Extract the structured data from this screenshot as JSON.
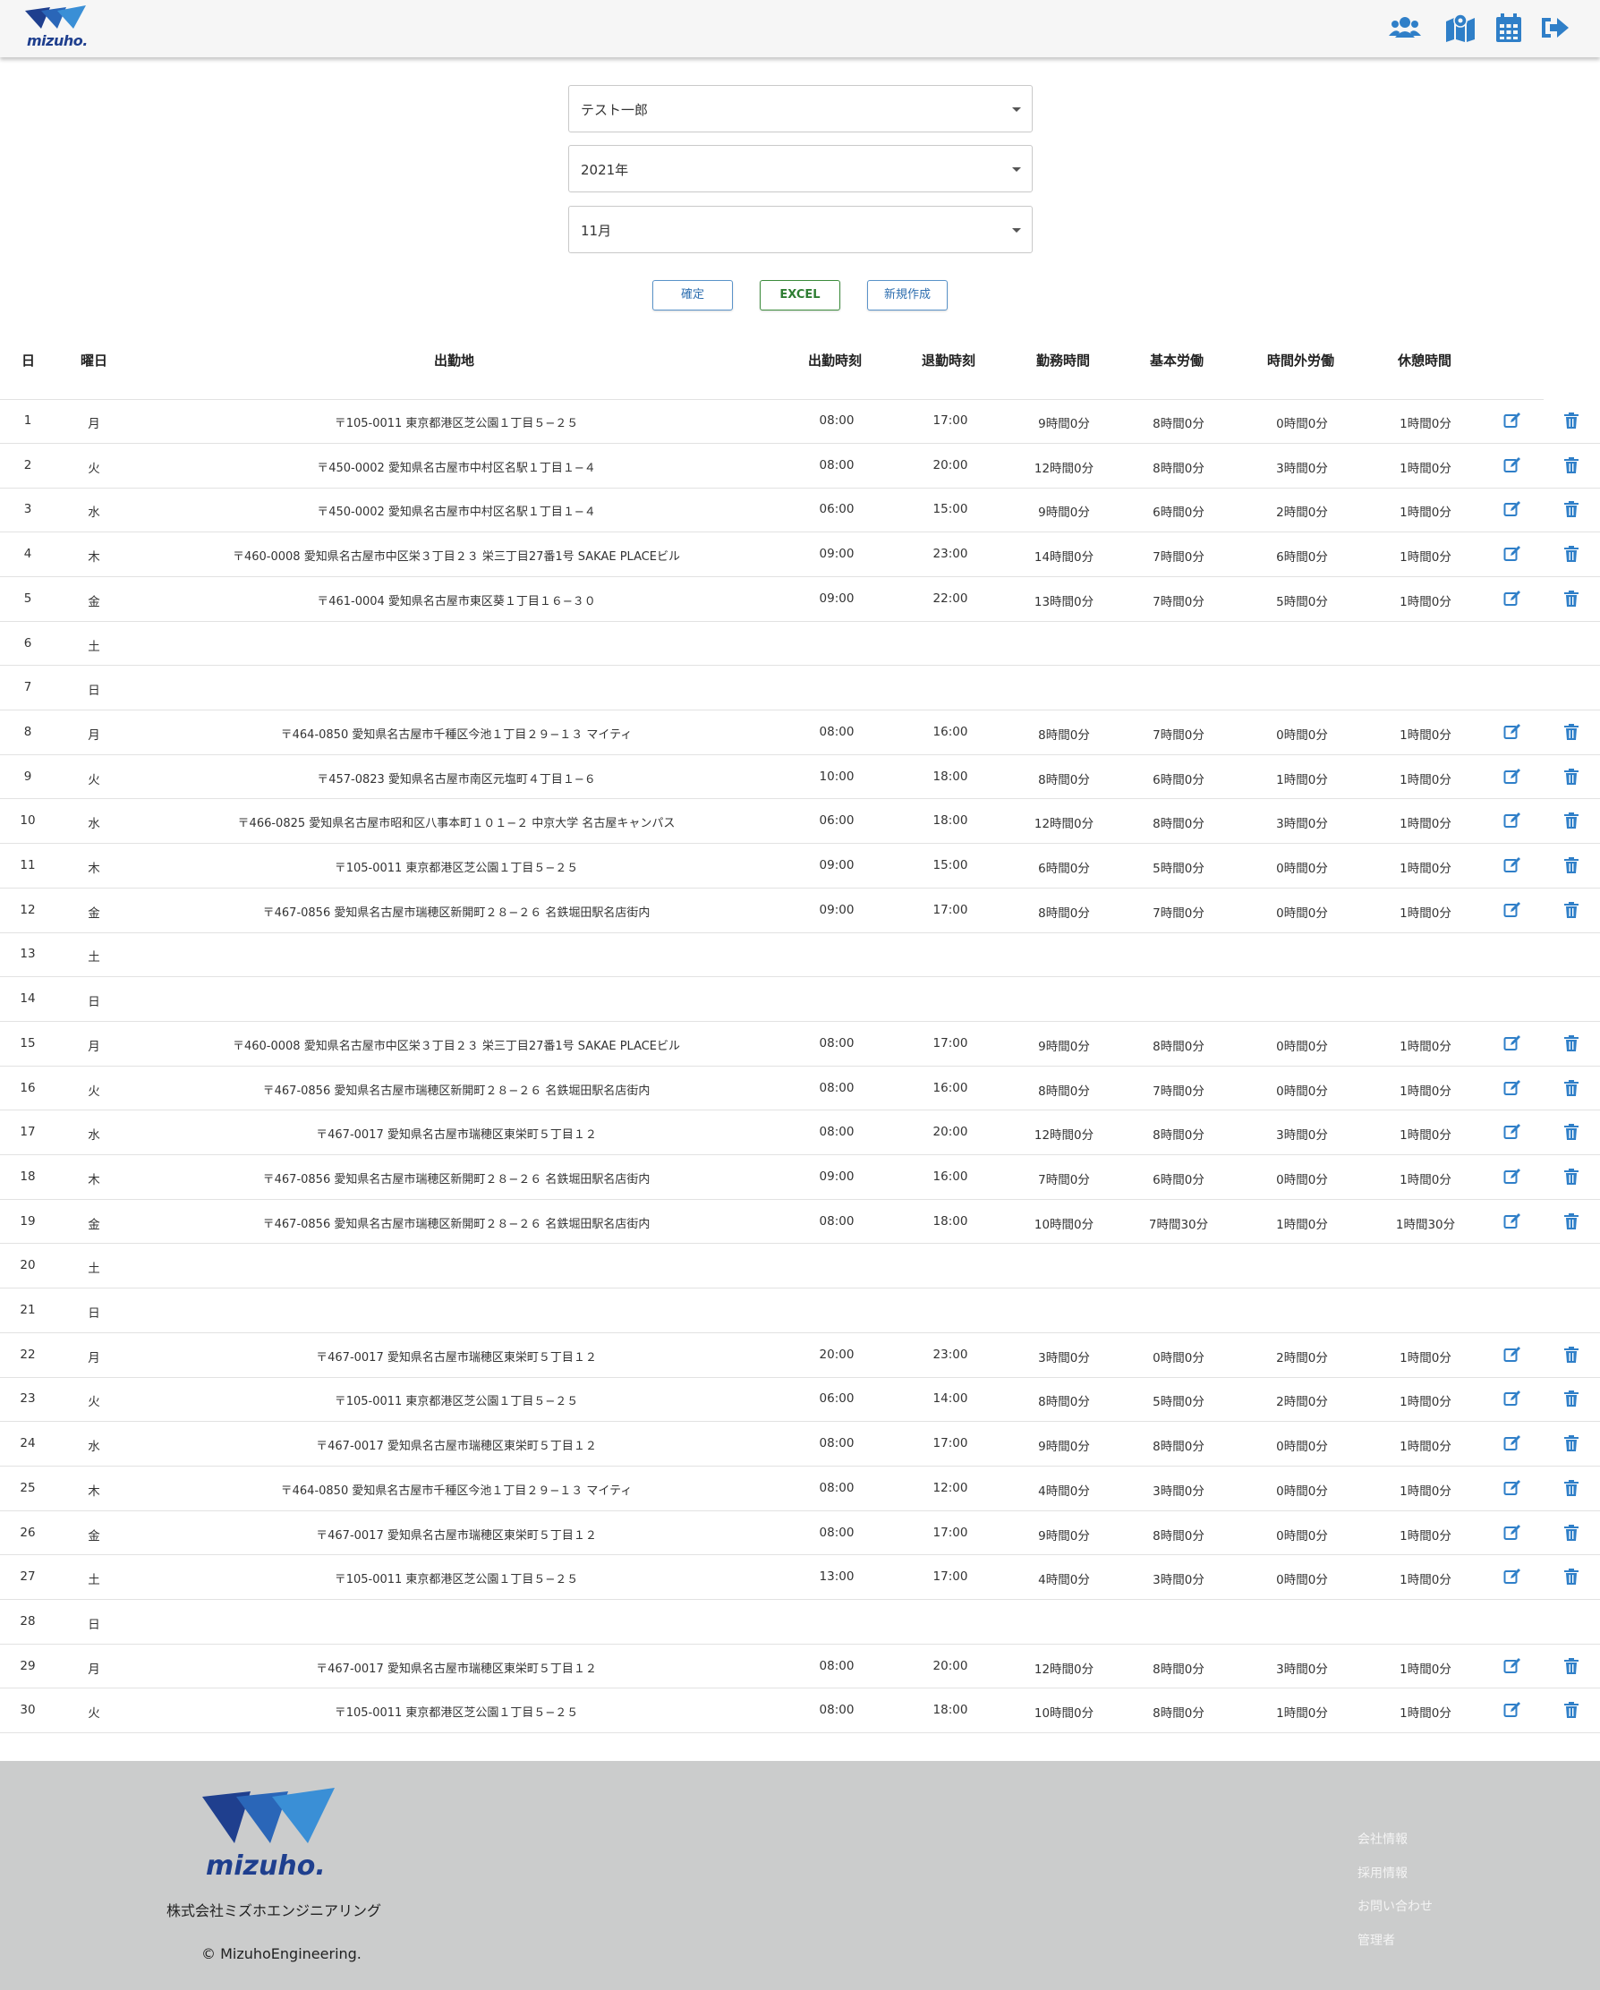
{
  "brand": {
    "logo_text": "mizuho."
  },
  "header": {
    "icons": [
      "users-icon",
      "map-icon",
      "calendar-icon",
      "logout-icon"
    ]
  },
  "filters": {
    "employee": "テスト一郎",
    "year": "2021年",
    "month": "11月"
  },
  "buttons": {
    "confirm": "確定",
    "excel": "EXCEL",
    "create": "新規作成"
  },
  "table": {
    "headers": [
      "日",
      "曜日",
      "出勤地",
      "出勤時刻",
      "退勤時刻",
      "勤務時間",
      "基本労働",
      "時間外労働",
      "休憩時間"
    ],
    "rows": [
      {
        "day": "1",
        "dow": "月",
        "place": "〒105-0011 東京都港区芝公園１丁目５−２５",
        "in": "08:00",
        "out": "17:00",
        "work": "9時間0分",
        "basic": "8時間0分",
        "over": "0時間0分",
        "rest": "1時間0分"
      },
      {
        "day": "2",
        "dow": "火",
        "place": "〒450-0002 愛知県名古屋市中村区名駅１丁目１−４",
        "in": "08:00",
        "out": "20:00",
        "work": "12時間0分",
        "basic": "8時間0分",
        "over": "3時間0分",
        "rest": "1時間0分"
      },
      {
        "day": "3",
        "dow": "水",
        "place": "〒450-0002 愛知県名古屋市中村区名駅１丁目１−４",
        "in": "06:00",
        "out": "15:00",
        "work": "9時間0分",
        "basic": "6時間0分",
        "over": "2時間0分",
        "rest": "1時間0分"
      },
      {
        "day": "4",
        "dow": "木",
        "place": "〒460-0008 愛知県名古屋市中区栄３丁目２３ 栄三丁目27番1号 SAKAE PLACEビル",
        "in": "09:00",
        "out": "23:00",
        "work": "14時間0分",
        "basic": "7時間0分",
        "over": "6時間0分",
        "rest": "1時間0分"
      },
      {
        "day": "5",
        "dow": "金",
        "place": "〒461-0004 愛知県名古屋市東区葵１丁目１６−３０",
        "in": "09:00",
        "out": "22:00",
        "work": "13時間0分",
        "basic": "7時間0分",
        "over": "5時間0分",
        "rest": "1時間0分"
      },
      {
        "day": "6",
        "dow": "土",
        "place": "",
        "in": "",
        "out": "",
        "work": "",
        "basic": "",
        "over": "",
        "rest": ""
      },
      {
        "day": "7",
        "dow": "日",
        "place": "",
        "in": "",
        "out": "",
        "work": "",
        "basic": "",
        "over": "",
        "rest": ""
      },
      {
        "day": "8",
        "dow": "月",
        "place": "〒464-0850 愛知県名古屋市千種区今池１丁目２９−１３ マイティ",
        "in": "08:00",
        "out": "16:00",
        "work": "8時間0分",
        "basic": "7時間0分",
        "over": "0時間0分",
        "rest": "1時間0分"
      },
      {
        "day": "9",
        "dow": "火",
        "place": "〒457-0823 愛知県名古屋市南区元塩町４丁目１−６",
        "in": "10:00",
        "out": "18:00",
        "work": "8時間0分",
        "basic": "6時間0分",
        "over": "1時間0分",
        "rest": "1時間0分"
      },
      {
        "day": "10",
        "dow": "水",
        "place": "〒466-0825 愛知県名古屋市昭和区八事本町１０１−２ 中京大学 名古屋キャンパス",
        "in": "06:00",
        "out": "18:00",
        "work": "12時間0分",
        "basic": "8時間0分",
        "over": "3時間0分",
        "rest": "1時間0分"
      },
      {
        "day": "11",
        "dow": "木",
        "place": "〒105-0011 東京都港区芝公園１丁目５−２５",
        "in": "09:00",
        "out": "15:00",
        "work": "6時間0分",
        "basic": "5時間0分",
        "over": "0時間0分",
        "rest": "1時間0分"
      },
      {
        "day": "12",
        "dow": "金",
        "place": "〒467-0856 愛知県名古屋市瑞穂区新開町２８−２６ 名鉄堀田駅名店街内",
        "in": "09:00",
        "out": "17:00",
        "work": "8時間0分",
        "basic": "7時間0分",
        "over": "0時間0分",
        "rest": "1時間0分"
      },
      {
        "day": "13",
        "dow": "土",
        "place": "",
        "in": "",
        "out": "",
        "work": "",
        "basic": "",
        "over": "",
        "rest": ""
      },
      {
        "day": "14",
        "dow": "日",
        "place": "",
        "in": "",
        "out": "",
        "work": "",
        "basic": "",
        "over": "",
        "rest": ""
      },
      {
        "day": "15",
        "dow": "月",
        "place": "〒460-0008 愛知県名古屋市中区栄３丁目２３ 栄三丁目27番1号 SAKAE PLACEビル",
        "in": "08:00",
        "out": "17:00",
        "work": "9時間0分",
        "basic": "8時間0分",
        "over": "0時間0分",
        "rest": "1時間0分"
      },
      {
        "day": "16",
        "dow": "火",
        "place": "〒467-0856 愛知県名古屋市瑞穂区新開町２８−２６ 名鉄堀田駅名店街内",
        "in": "08:00",
        "out": "16:00",
        "work": "8時間0分",
        "basic": "7時間0分",
        "over": "0時間0分",
        "rest": "1時間0分"
      },
      {
        "day": "17",
        "dow": "水",
        "place": "〒467-0017 愛知県名古屋市瑞穂区東栄町５丁目１２",
        "in": "08:00",
        "out": "20:00",
        "work": "12時間0分",
        "basic": "8時間0分",
        "over": "3時間0分",
        "rest": "1時間0分"
      },
      {
        "day": "18",
        "dow": "木",
        "place": "〒467-0856 愛知県名古屋市瑞穂区新開町２８−２６ 名鉄堀田駅名店街内",
        "in": "09:00",
        "out": "16:00",
        "work": "7時間0分",
        "basic": "6時間0分",
        "over": "0時間0分",
        "rest": "1時間0分"
      },
      {
        "day": "19",
        "dow": "金",
        "place": "〒467-0856 愛知県名古屋市瑞穂区新開町２８−２６ 名鉄堀田駅名店街内",
        "in": "08:00",
        "out": "18:00",
        "work": "10時間0分",
        "basic": "7時間30分",
        "over": "1時間0分",
        "rest": "1時間30分"
      },
      {
        "day": "20",
        "dow": "土",
        "place": "",
        "in": "",
        "out": "",
        "work": "",
        "basic": "",
        "over": "",
        "rest": ""
      },
      {
        "day": "21",
        "dow": "日",
        "place": "",
        "in": "",
        "out": "",
        "work": "",
        "basic": "",
        "over": "",
        "rest": ""
      },
      {
        "day": "22",
        "dow": "月",
        "place": "〒467-0017 愛知県名古屋市瑞穂区東栄町５丁目１２",
        "in": "20:00",
        "out": "23:00",
        "work": "3時間0分",
        "basic": "0時間0分",
        "over": "2時間0分",
        "rest": "1時間0分"
      },
      {
        "day": "23",
        "dow": "火",
        "place": "〒105-0011 東京都港区芝公園１丁目５−２５",
        "in": "06:00",
        "out": "14:00",
        "work": "8時間0分",
        "basic": "5時間0分",
        "over": "2時間0分",
        "rest": "1時間0分"
      },
      {
        "day": "24",
        "dow": "水",
        "place": "〒467-0017 愛知県名古屋市瑞穂区東栄町５丁目１２",
        "in": "08:00",
        "out": "17:00",
        "work": "9時間0分",
        "basic": "8時間0分",
        "over": "0時間0分",
        "rest": "1時間0分"
      },
      {
        "day": "25",
        "dow": "木",
        "place": "〒464-0850 愛知県名古屋市千種区今池１丁目２９−１３ マイティ",
        "in": "08:00",
        "out": "12:00",
        "work": "4時間0分",
        "basic": "3時間0分",
        "over": "0時間0分",
        "rest": "1時間0分"
      },
      {
        "day": "26",
        "dow": "金",
        "place": "〒467-0017 愛知県名古屋市瑞穂区東栄町５丁目１２",
        "in": "08:00",
        "out": "17:00",
        "work": "9時間0分",
        "basic": "8時間0分",
        "over": "0時間0分",
        "rest": "1時間0分"
      },
      {
        "day": "27",
        "dow": "土",
        "place": "〒105-0011 東京都港区芝公園１丁目５−２５",
        "in": "13:00",
        "out": "17:00",
        "work": "4時間0分",
        "basic": "3時間0分",
        "over": "0時間0分",
        "rest": "1時間0分"
      },
      {
        "day": "28",
        "dow": "日",
        "place": "",
        "in": "",
        "out": "",
        "work": "",
        "basic": "",
        "over": "",
        "rest": ""
      },
      {
        "day": "29",
        "dow": "月",
        "place": "〒467-0017 愛知県名古屋市瑞穂区東栄町５丁目１２",
        "in": "08:00",
        "out": "20:00",
        "work": "12時間0分",
        "basic": "8時間0分",
        "over": "3時間0分",
        "rest": "1時間0分"
      },
      {
        "day": "30",
        "dow": "火",
        "place": "〒105-0011 東京都港区芝公園１丁目５−２５",
        "in": "08:00",
        "out": "18:00",
        "work": "10時間0分",
        "basic": "8時間0分",
        "over": "1時間0分",
        "rest": "1時間0分"
      }
    ]
  },
  "footer": {
    "logo_text": "mizuho.",
    "company": "株式会社ミズホエンジニアリング",
    "copyright": "© MizuhoEngineering.",
    "links": [
      "会社情報",
      "採用情報",
      "お問い合わせ",
      "管理者"
    ]
  },
  "colors": {
    "brand_dark": "#1f3f8e",
    "brand_light": "#3a8fd6",
    "action_blue": "#2f7fc8",
    "footer_bg": "#cbcccc"
  }
}
